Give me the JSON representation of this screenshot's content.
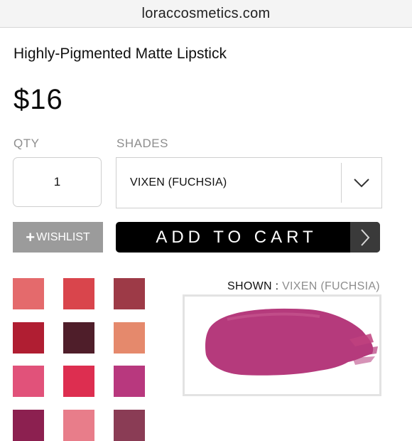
{
  "browser": {
    "url": "loraccosmetics.com"
  },
  "product": {
    "title": "Highly-Pigmented Matte Lipstick",
    "price": "$16"
  },
  "qty": {
    "label": "QTY",
    "value": "1"
  },
  "shades": {
    "label": "SHADES",
    "selected": "VIXEN (FUCHSIA)",
    "swatches": [
      {
        "color": "#e46a6c"
      },
      {
        "color": "#d9454c"
      },
      {
        "color": "#9d3a47"
      },
      {
        "color": "#b01e32"
      },
      {
        "color": "#4f1e2a"
      },
      {
        "color": "#e5896c"
      },
      {
        "color": "#e1527a"
      },
      {
        "color": "#dd2e50"
      },
      {
        "color": "#b8387e"
      },
      {
        "color": "#8c2050"
      },
      {
        "color": "#e87d8a"
      },
      {
        "color": "#8a3c55"
      }
    ]
  },
  "actions": {
    "wishlist_label": "WISHLIST",
    "add_to_cart_label": "ADD TO CART"
  },
  "shown": {
    "prefix": "SHOWN : ",
    "value": "VIXEN (FUCHSIA)"
  },
  "icons": {
    "wishlist": "plus-icon",
    "dropdown": "chevron-down-icon",
    "cart": "chevron-right-icon"
  },
  "colors": {
    "accent": "#000000",
    "swatch_shown": "#b53a7c"
  }
}
